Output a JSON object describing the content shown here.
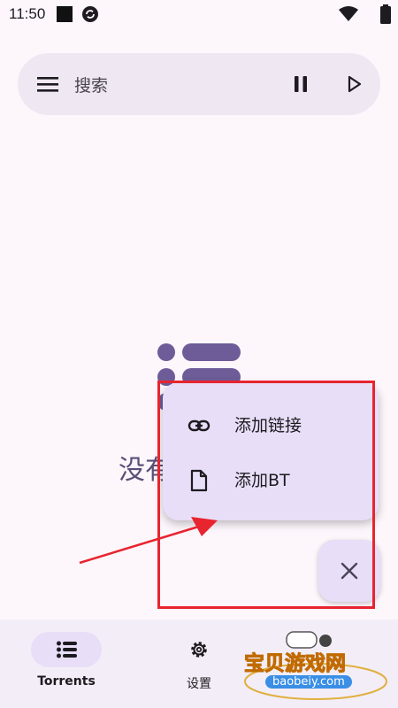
{
  "status_bar": {
    "time": "11:50",
    "icons": [
      "notification-square-icon",
      "sync-icon",
      "wifi-icon",
      "battery-icon"
    ]
  },
  "search_bar": {
    "placeholder": "搜索",
    "icons": [
      "menu-icon",
      "pause-icon",
      "play-icon"
    ]
  },
  "empty_state": {
    "text": "没有"
  },
  "add_menu": {
    "items": [
      {
        "label": "添加链接",
        "icon": "link-icon"
      },
      {
        "label": "添加BT",
        "icon": "file-icon"
      }
    ]
  },
  "fab": {
    "icon": "close-icon"
  },
  "bottom_nav": {
    "items": [
      {
        "label": "Torrents",
        "icon": "list-icon",
        "selected": true
      },
      {
        "label": "设置",
        "icon": "gear-icon",
        "selected": false
      }
    ]
  },
  "watermark": {
    "text": "宝贝游戏网",
    "url": "baobeiy.com"
  },
  "colors": {
    "background": "#fdf7fc",
    "surface": "#efe7f1",
    "accent_container": "#e8def8",
    "illustration": "#6d5c98",
    "annotation": "#e8242f"
  }
}
